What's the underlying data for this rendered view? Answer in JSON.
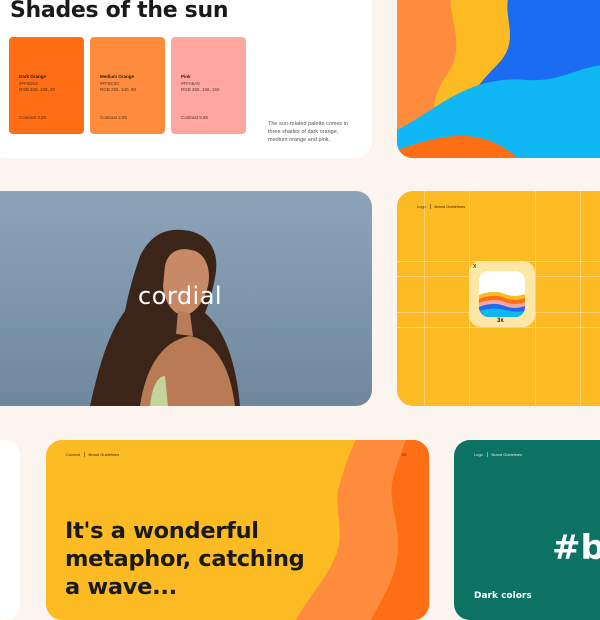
{
  "palette_card": {
    "title": "Shades of the sun",
    "description": "The sun-related palette comes in three shades of dark orange, medium orange and pink.",
    "swatches": [
      {
        "name": "Dark Orange",
        "hex": "#FF6D14",
        "rgb": "RGB 255, 109, 20",
        "contrast": "Contrast 3.28",
        "color": "#ff6d14"
      },
      {
        "name": "Medium Orange",
        "hex": "#FF8C3C",
        "rgb": "RGB 255, 140, 60",
        "contrast": "Contrast 2.85",
        "color": "#ff8c3c"
      },
      {
        "name": "Pink",
        "hex": "#FFA6A0",
        "rgb": "RGB 255, 166, 160",
        "contrast": "Contrast 9.85",
        "color": "#ffa6a0"
      }
    ]
  },
  "photo_card": {
    "logo_text": "cordial"
  },
  "logo_grid_card": {
    "header": {
      "section": "Logo",
      "doc": "Brand Guidelines"
    },
    "x_label": "x",
    "scale_label": "3x"
  },
  "quote_card": {
    "header": {
      "section": "Content",
      "doc": "Brand Guidelines",
      "page": "03"
    },
    "quote_line_1": "It's a wonderful",
    "quote_line_2": "metaphor, catching",
    "quote_line_3": "a wave..."
  },
  "dark_card": {
    "header": {
      "section": "Logo",
      "doc": "Brand Guidelines"
    },
    "hash_text": "#b",
    "label": "Dark colors"
  },
  "colors": {
    "background": "#fbf4ef",
    "yellow": "#fcbb22",
    "orange": "#ff6d14",
    "blue": "#1b6cf2",
    "light_blue": "#0fb8f5",
    "teal": "#0b7264"
  }
}
